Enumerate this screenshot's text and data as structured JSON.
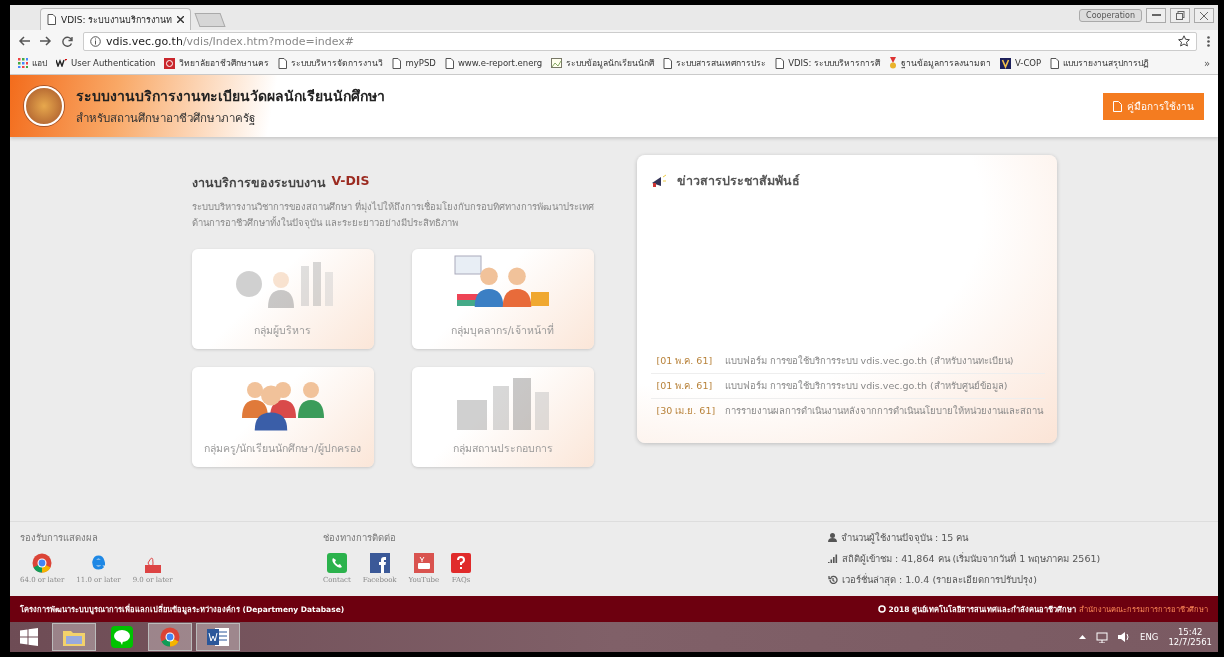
{
  "browser": {
    "tab_title": "VDIS: ระบบงานบริการงานท",
    "profile": "Cooperation",
    "url_host": "vdis.vec.go.th",
    "url_path": "/vdis/Index.htm?mode=index#",
    "bookmarks": [
      {
        "kind": "apps",
        "label": "แอป"
      },
      {
        "kind": "w",
        "label": "User Authentication"
      },
      {
        "kind": "g",
        "label": "วิทยาลัยอาชีวศึกษานคร"
      },
      {
        "kind": "page",
        "label": "ระบบบริหารจัดการงานวิ"
      },
      {
        "kind": "page",
        "label": "myPSD"
      },
      {
        "kind": "page",
        "label": "www.e-report.energ"
      },
      {
        "kind": "image",
        "label": "ระบบข้อมูลนักเรียนนักศึ"
      },
      {
        "kind": "page",
        "label": "ระบบสารสนเทศการประ"
      },
      {
        "kind": "page",
        "label": "VDIS: ระบบบริหารการศึ"
      },
      {
        "kind": "medal",
        "label": "ฐานข้อมูลการลงนามตา"
      },
      {
        "kind": "v",
        "label": "V-COP"
      },
      {
        "kind": "page",
        "label": "แบบรายงานสรุปการปฏิ"
      }
    ],
    "more": "»"
  },
  "header": {
    "title": "ระบบงานบริการงานทะเบียนวัดผลนักเรียนนักศึกษา",
    "subtitle": "สำหรับสถานศึกษาอาชีวศึกษาภาครัฐ",
    "manual_button": "คู่มือการใช้งาน"
  },
  "services": {
    "heading": "งานบริการของระบบงาน",
    "heading_brand": "V-DIS",
    "description": "ระบบบริหารงานวิชาการของสถานศึกษา ที่มุ่งไปให้ถึงการเชื่อมโยงกับกรอบทิศทางการพัฒนาประเทศด้านการอาชีวศึกษาทั้งในปัจจุบัน และระยะยาวอย่างมีประสิทธิภาพ",
    "groups": [
      {
        "kind": "executive",
        "label": "กลุ่มผู้บริหาร"
      },
      {
        "kind": "staff",
        "label": "กลุ่มบุคลากร/เจ้าหน้าที่"
      },
      {
        "kind": "teacher",
        "label": "กลุ่มครู/นักเรียนนักศึกษา/ผู้ปกครอง"
      },
      {
        "kind": "business",
        "label": "กลุ่มสถานประกอบการ"
      }
    ]
  },
  "news": {
    "title": "ข่าวสารประชาสัมพันธ์",
    "items": [
      {
        "date": "[01 พ.ค. 61]",
        "text": "แบบฟอร์ม การขอใช้บริการระบบ vdis.vec.go.th (สำหรับงานทะเบียน)"
      },
      {
        "date": "[01 พ.ค. 61]",
        "text": "แบบฟอร์ม การขอใช้บริการระบบ vdis.vec.go.th (สำหรับศูนย์ข้อมูล)"
      },
      {
        "date": "[30 เม.ย. 61]",
        "text": "การรายงานผลการดำเนินงานหลังจากการดำเนินนโยบายให้หน่วยงานและสถาน"
      }
    ]
  },
  "footer": {
    "browsers_title": "รองรับการแสดงผล",
    "browsers": [
      {
        "kind": "chrome",
        "label": "64.0 or later"
      },
      {
        "kind": "ie",
        "label": "11.0 or later"
      },
      {
        "kind": "pdf",
        "label": "9.0 or later"
      }
    ],
    "contact_title": "ช่องทางการติดต่อ",
    "contacts": [
      {
        "kind": "phone",
        "label": "Contact"
      },
      {
        "kind": "facebook",
        "label": "Facebook"
      },
      {
        "kind": "youtube",
        "label": "YouTube"
      },
      {
        "kind": "faq",
        "label": "FAQs"
      }
    ],
    "stats": [
      {
        "kind": "users",
        "text": "จำนวนผู้ใช้งานปัจจุบัน : 15 คน"
      },
      {
        "kind": "visits",
        "text": "สถิติผู้เข้าชม : 41,864 คน (เริ่มนับจากวันที่ 1 พฤษภาคม 2561)"
      },
      {
        "kind": "version",
        "text": "เวอร์ชั่นล่าสุด : 1.0.4 (รายละเอียดการปรับปรุง)"
      }
    ],
    "project": "โครงการพัฒนาระบบบูรณาการเพื่อแลกเปลี่ยนข้อมูลระหว่างองค์กร (Departmeny Database)",
    "copyright": "2018 ศูนย์เทคโนโลยีสารสนเทศและกำลังคนอาชีวศึกษา",
    "office_link": "สำนักงานคณะกรรมการการอาชีวศึกษา"
  },
  "taskbar": {
    "apps": [
      {
        "kind": "explorer",
        "running": true
      },
      {
        "kind": "line",
        "running": false
      },
      {
        "kind": "chrome",
        "running": true
      },
      {
        "kind": "word",
        "running": true
      }
    ],
    "language": "ENG",
    "time": "15:42",
    "date": "12/7/2561"
  }
}
